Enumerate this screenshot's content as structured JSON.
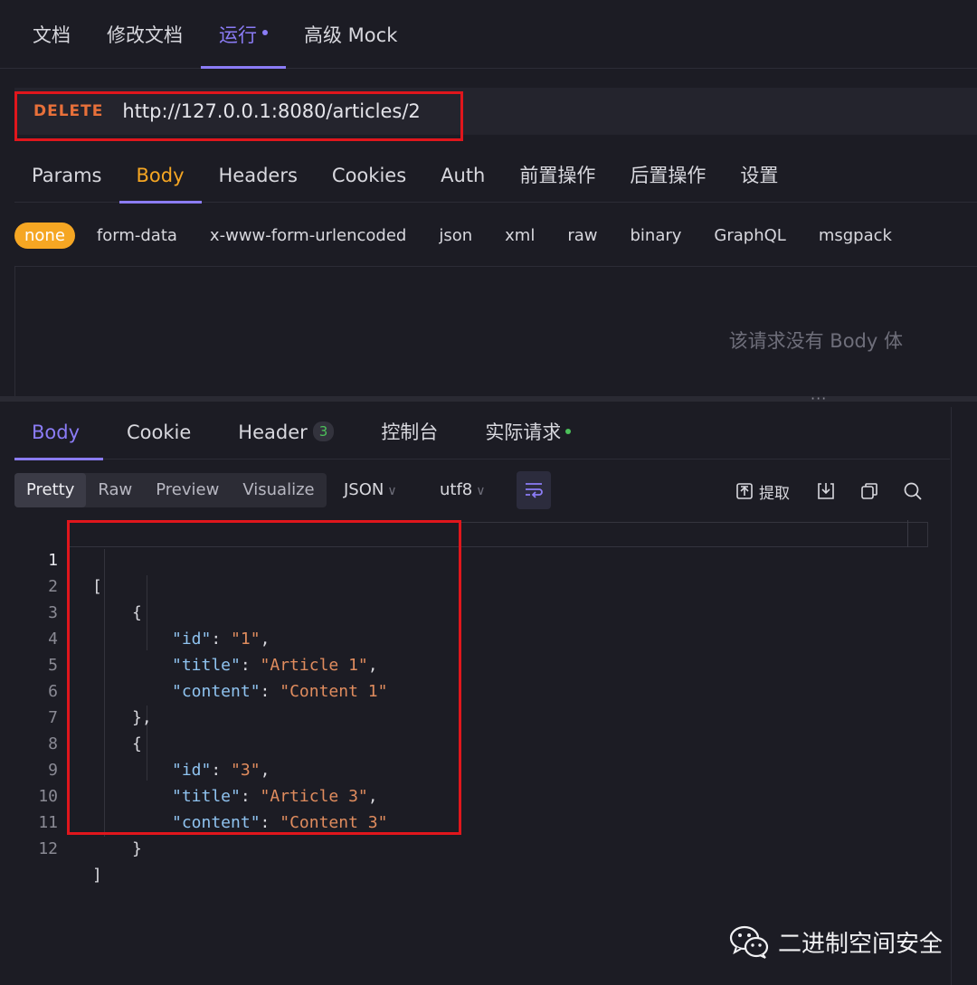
{
  "top_tabs": [
    {
      "label": "文档"
    },
    {
      "label": "修改文档"
    },
    {
      "label": "运行"
    },
    {
      "label": "高级 Mock"
    }
  ],
  "request": {
    "method": "DELETE",
    "url": "http://127.0.0.1:8080/articles/2"
  },
  "request_tabs": [
    "Params",
    "Body",
    "Headers",
    "Cookies",
    "Auth",
    "前置操作",
    "后置操作",
    "设置"
  ],
  "body_types": [
    "none",
    "form-data",
    "x-www-form-urlencoded",
    "json",
    "xml",
    "raw",
    "binary",
    "GraphQL",
    "msgpack"
  ],
  "empty_body_text": "该请求没有 Body 体",
  "splitter_handle": "···",
  "response_tabs": {
    "body": "Body",
    "cookie": "Cookie",
    "header": "Header",
    "header_count": "3",
    "console": "控制台",
    "actual_request": "实际请求"
  },
  "view_modes": [
    "Pretty",
    "Raw",
    "Preview",
    "Visualize"
  ],
  "format_select": "JSON",
  "encoding_select": "utf8",
  "toolbar": {
    "extract_label": "提取"
  },
  "code": {
    "line_numbers": [
      "1",
      "2",
      "3",
      "4",
      "5",
      "6",
      "7",
      "8",
      "9",
      "10",
      "11",
      "12"
    ],
    "articles": [
      {
        "id": "\"1\"",
        "title": "\"Article 1\"",
        "content": "\"Content 1\""
      },
      {
        "id": "\"3\"",
        "title": "\"Article 3\"",
        "content": "\"Content 3\""
      }
    ],
    "keys": {
      "id": "\"id\"",
      "title": "\"title\"",
      "content": "\"content\""
    },
    "punct": {
      "open_array": "[",
      "close_array": "]",
      "open_obj": "{",
      "close_obj_comma": "},",
      "close_obj": "}"
    }
  },
  "watermark": "二进制空间安全",
  "colors": {
    "accent_purple": "#8b7cf6",
    "accent_orange": "#f5a623",
    "method_delete": "#e8703a",
    "highlight_red": "#e0161c",
    "json_key": "#8fc3f0",
    "json_string": "#e08c5e"
  }
}
